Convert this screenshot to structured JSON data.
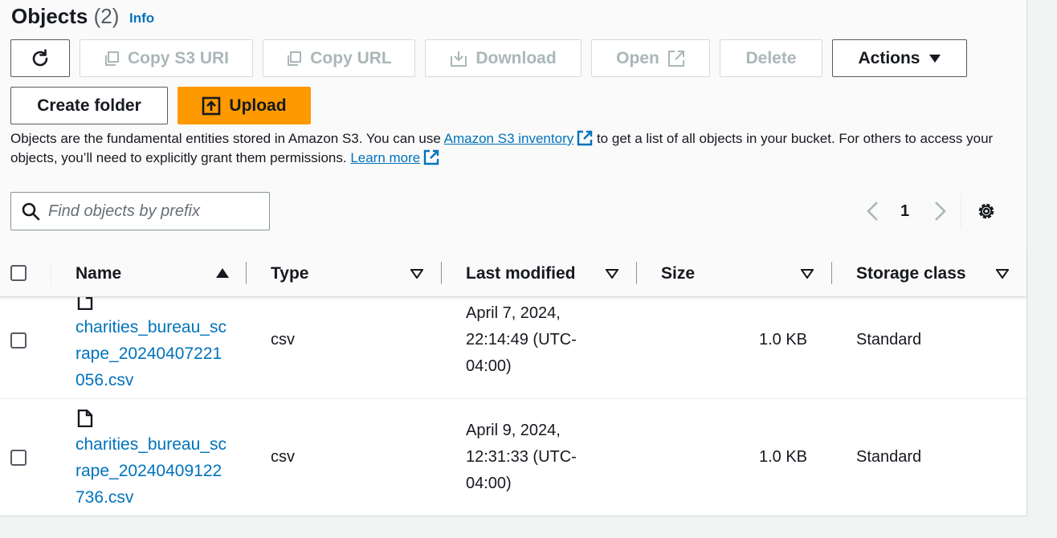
{
  "header": {
    "title": "Objects",
    "count": "(2)",
    "info": "Info"
  },
  "toolbar": {
    "refresh_label": "",
    "copy_s3_uri": "Copy S3 URI",
    "copy_url": "Copy URL",
    "download": "Download",
    "open": "Open",
    "delete": "Delete",
    "actions": "Actions",
    "create_folder": "Create folder",
    "upload": "Upload"
  },
  "description": {
    "part1": "Objects are the fundamental entities stored in Amazon S3. You can use ",
    "link1": "Amazon S3 inventory",
    "part2": " to get a list of all objects in your bucket. For others to access your objects, you’ll need to explicitly grant them permissions. ",
    "link2": "Learn more"
  },
  "search": {
    "placeholder": "Find objects by prefix",
    "value": ""
  },
  "pagination": {
    "current_page": "1"
  },
  "table": {
    "columns": [
      "Name",
      "Type",
      "Last modified",
      "Size",
      "Storage class"
    ],
    "rows": [
      {
        "name": "charities_bureau_scrape_20240407221056.csv",
        "type": "csv",
        "last_modified": "April 7, 2024, 22:14:49 (UTC-04:00)",
        "size": "1.0 KB",
        "storage_class": "Standard"
      },
      {
        "name": "charities_bureau_scrape_20240409122736.csv",
        "type": "csv",
        "last_modified": "April 9, 2024, 12:31:33 (UTC-04:00)",
        "size": "1.0 KB",
        "storage_class": "Standard"
      }
    ]
  },
  "colors": {
    "primary": "#ff9900",
    "link": "#0073bb",
    "disabled": "#aab7b8"
  },
  "icons": {
    "refresh": "refresh-icon",
    "copy": "copy-icon",
    "download": "download-icon",
    "external": "external-link-icon",
    "caret": "caret-down-icon",
    "upload": "upload-icon",
    "search": "search-icon",
    "settings": "gear-icon",
    "file": "file-icon"
  }
}
